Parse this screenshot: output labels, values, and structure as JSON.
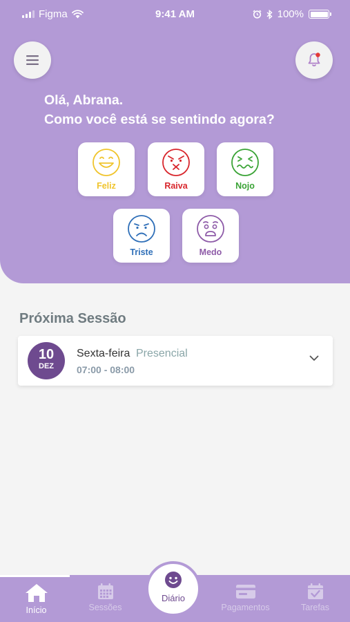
{
  "status_bar": {
    "carrier": "Figma",
    "time": "9:41 AM",
    "battery": "100%",
    "battery_level": 1.0,
    "icons": [
      "signal-icon",
      "wifi-icon",
      "alarm-icon",
      "bluetooth-icon",
      "battery-icon"
    ]
  },
  "header": {
    "greeting_line1": "Olá, Abrana.",
    "greeting_line2": "Como você está se sentindo agora?",
    "menu_icon": "menu-icon",
    "bell_icon": "bell-icon",
    "has_notification": true
  },
  "moods": [
    {
      "label": "Feliz",
      "icon": "happy-face-icon",
      "color": "#f0c42c"
    },
    {
      "label": "Raiva",
      "icon": "angry-face-icon",
      "color": "#d8262c"
    },
    {
      "label": "Nojo",
      "icon": "disgusted-face-icon",
      "color": "#3aa335"
    },
    {
      "label": "Triste",
      "icon": "sad-face-icon",
      "color": "#2f6fb8"
    },
    {
      "label": "Medo",
      "icon": "fearful-face-icon",
      "color": "#8e5ba8"
    }
  ],
  "next_session": {
    "title": "Próxima Sessão",
    "day": "10",
    "month": "DEZ",
    "weekday": "Sexta-feira",
    "type": "Presencial",
    "time": "07:00 - 08:00"
  },
  "tabs": [
    {
      "label": "Início",
      "icon": "home-icon",
      "active": true
    },
    {
      "label": "Sessões",
      "icon": "calendar-icon",
      "active": false
    },
    {
      "label": "Diário",
      "icon": "smiley-icon",
      "active": false
    },
    {
      "label": "Pagamentos",
      "icon": "credit-card-icon",
      "active": false
    },
    {
      "label": "Tarefas",
      "icon": "calendar-check-icon",
      "active": false
    }
  ],
  "colors": {
    "header_bg": "#b39ad6",
    "accent": "#6e4a8f",
    "page_bg": "#f4f4f4",
    "tab_inactive": "#d7cbe9"
  }
}
